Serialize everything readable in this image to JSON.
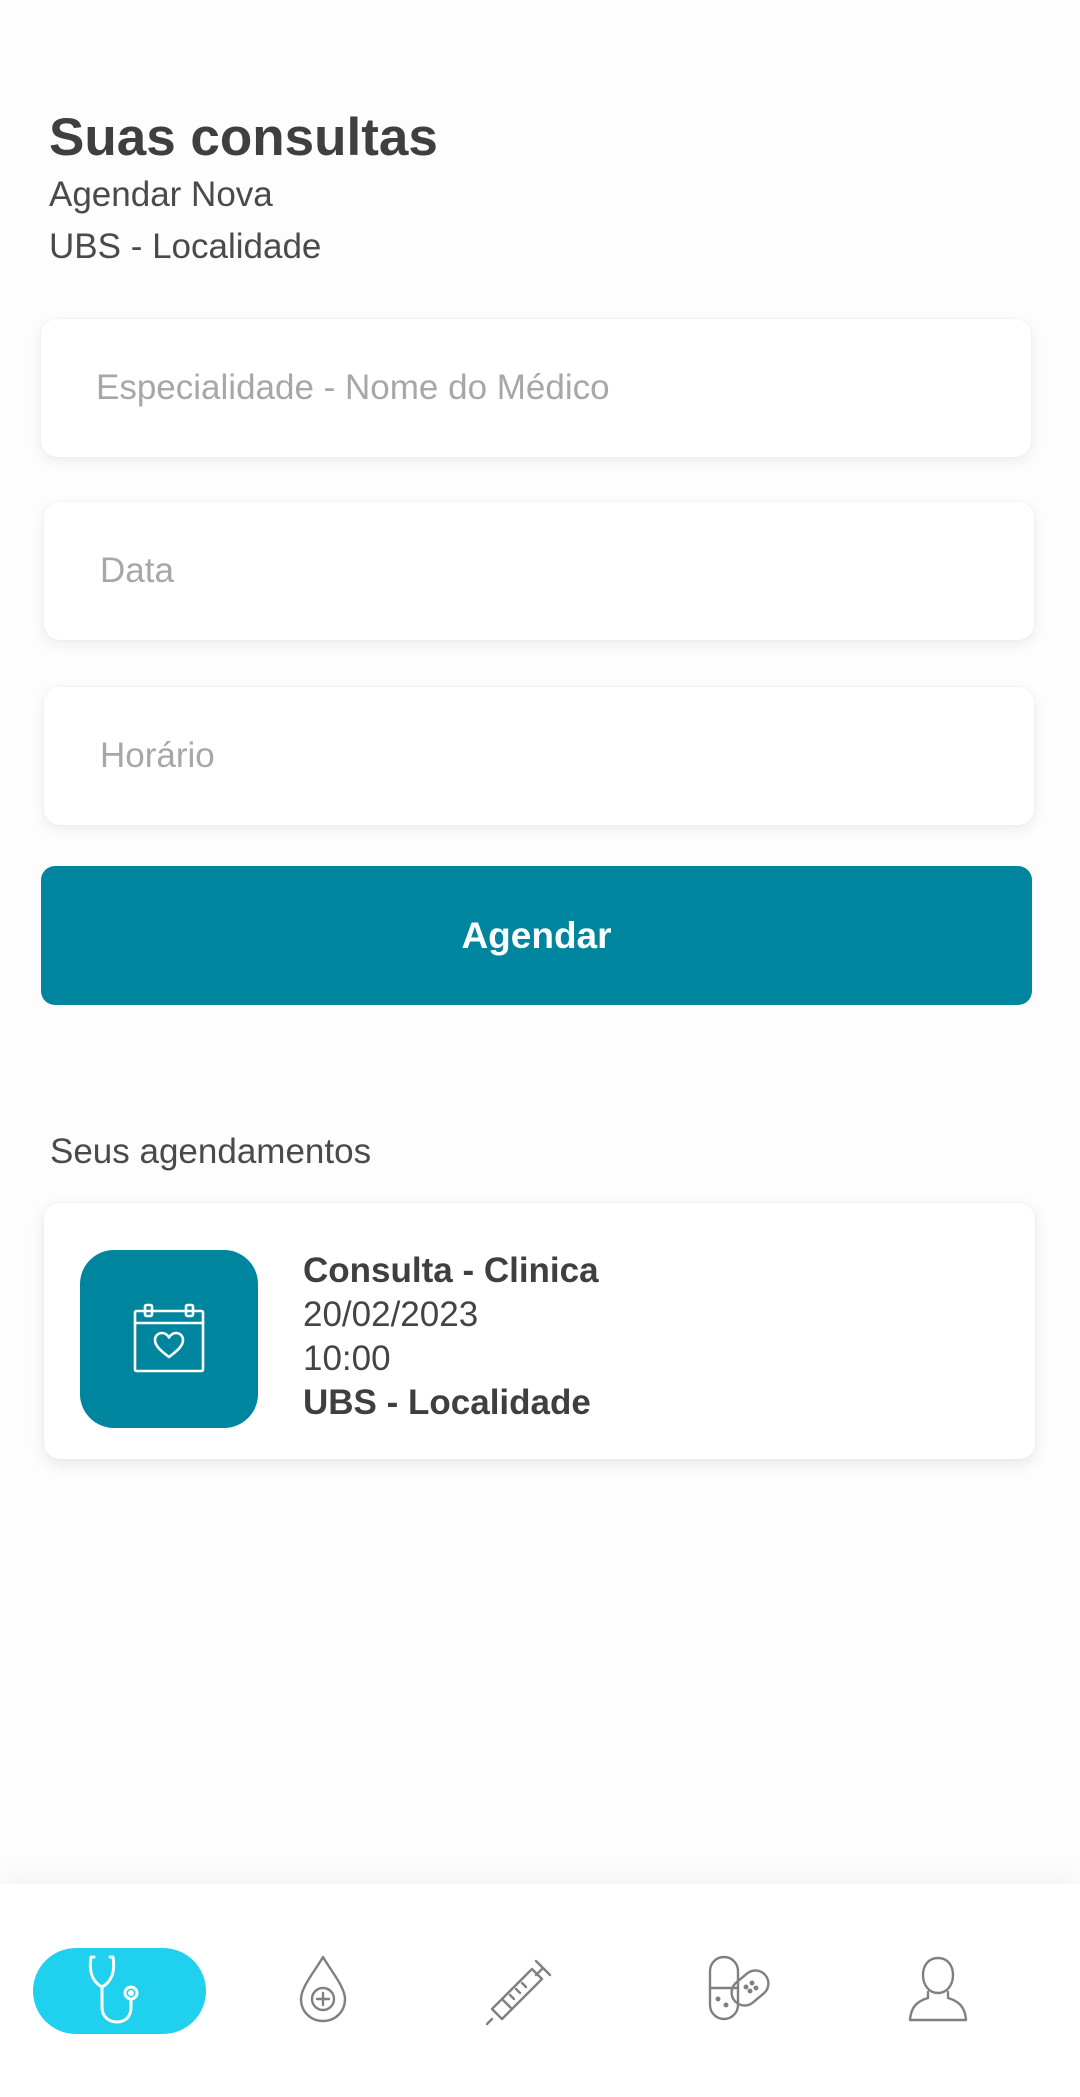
{
  "header": {
    "title": "Suas consultas",
    "subtitle": "Agendar Nova",
    "location": "UBS - Localidade"
  },
  "form": {
    "specialty_placeholder": "Especialidade - Nome do Médico",
    "date_placeholder": "Data",
    "time_placeholder": "Horário",
    "submit_label": "Agendar"
  },
  "appointments": {
    "section_label": "Seus agendamentos",
    "items": [
      {
        "icon": "calendar-heart-icon",
        "title": "Consulta - Clinica",
        "date": "20/02/2023",
        "time": "10:00",
        "location": "UBS - Localidade"
      }
    ]
  },
  "bottom_nav": {
    "active_index": 0,
    "items": [
      {
        "icon": "stethoscope-icon",
        "active": true
      },
      {
        "icon": "blood-drop-icon",
        "active": false
      },
      {
        "icon": "syringe-icon",
        "active": false
      },
      {
        "icon": "pill-bandage-icon",
        "active": false
      },
      {
        "icon": "user-icon",
        "active": false
      }
    ]
  },
  "colors": {
    "primary": "#00859f",
    "nav_active": "#1fd0ef",
    "text": "#444444",
    "placeholder": "#a7a7a7",
    "background": "#fdfdfd"
  }
}
